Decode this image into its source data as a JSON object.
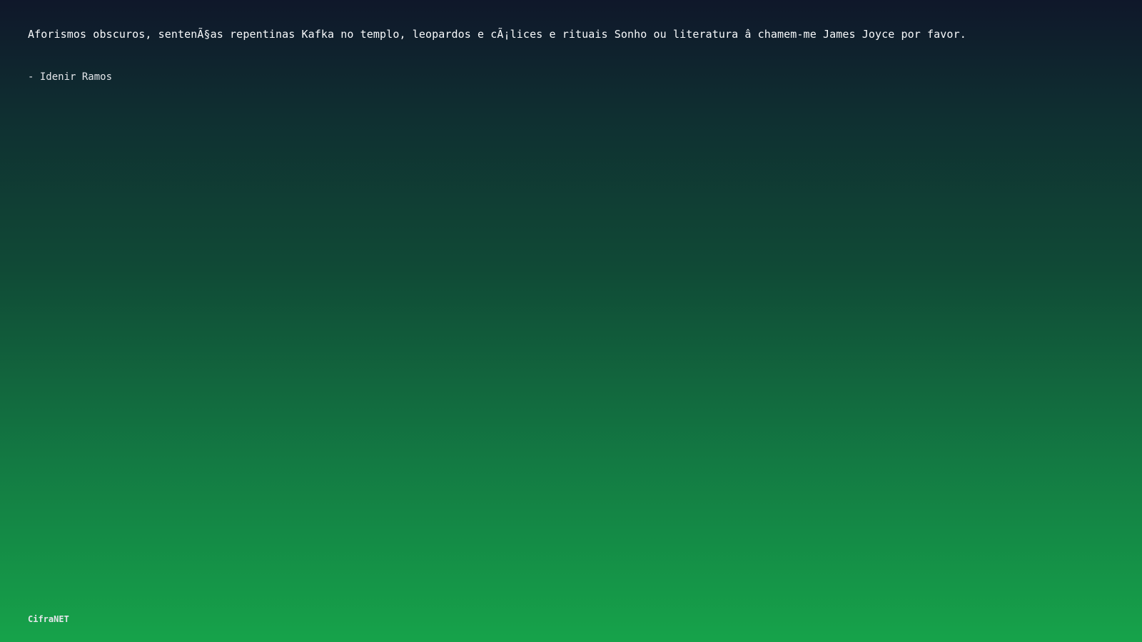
{
  "quote": {
    "text": "Aforismos obscuros, sentenÃ§as repentinas Kafka no templo, leopardos e cÃ¡lices e rituais Sonho ou literatura â   chamem-me James Joyce por favor."
  },
  "author": {
    "text": "- Idenir Ramos"
  },
  "footer": {
    "brand": "CifraNET"
  },
  "colors": {
    "text": "#f8fafc",
    "background_top": "#0f172a",
    "background_bottom": "#16a34a"
  }
}
